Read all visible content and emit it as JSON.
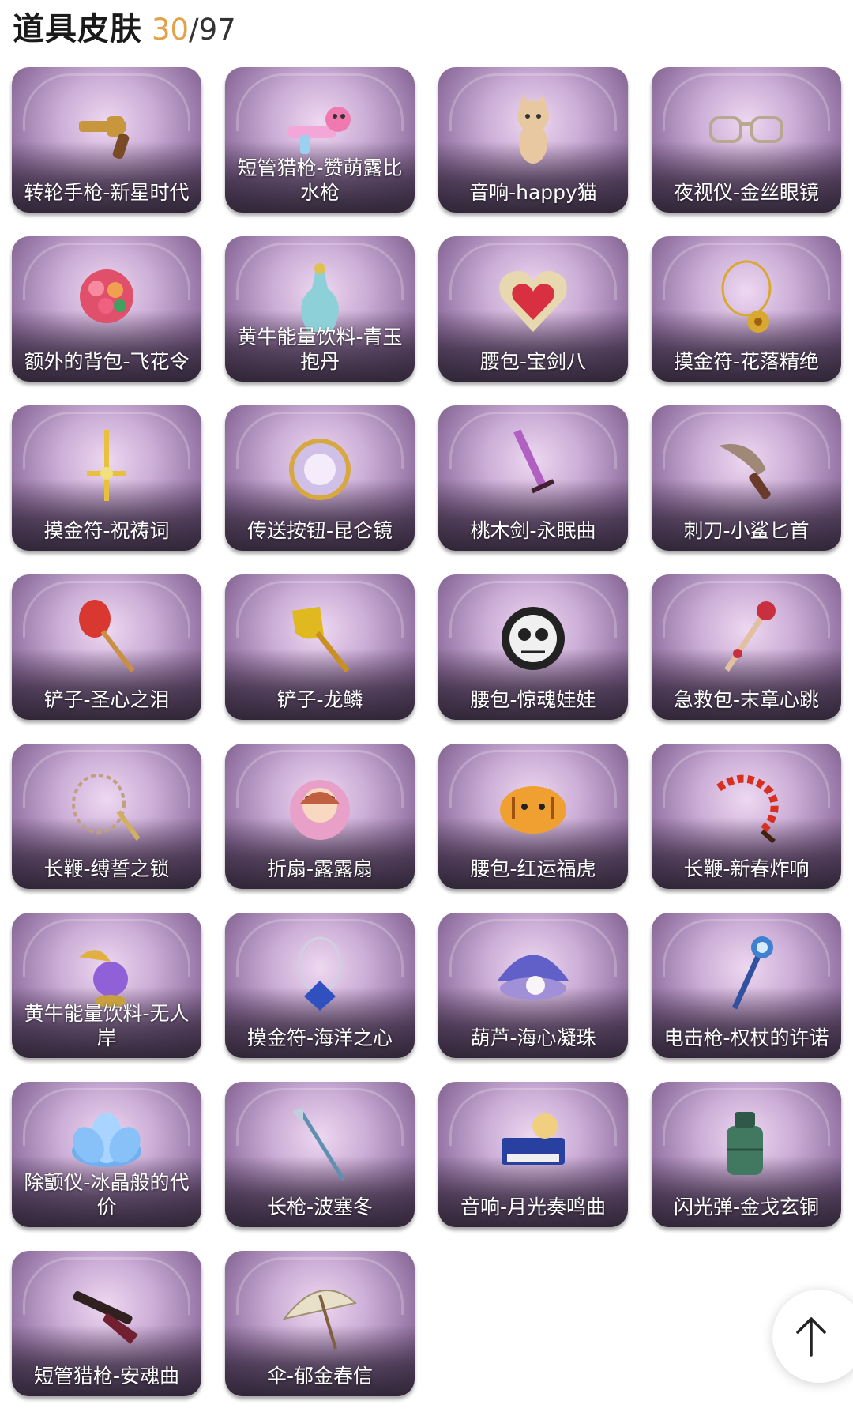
{
  "header": {
    "title": "道具皮肤",
    "count": "30",
    "slash": "/",
    "total": "97"
  },
  "items": [
    {
      "label": "转轮手枪-新星时代",
      "icon": "revolver-icon",
      "color": "#c8963c"
    },
    {
      "label": "短管猎枪-赞萌露比水枪",
      "icon": "water-gun-icon",
      "color": "#f2a7d8"
    },
    {
      "label": "音响-happy猫",
      "icon": "cat-icon",
      "color": "#e8c8a0"
    },
    {
      "label": "夜视仪-金丝眼镜",
      "icon": "glasses-icon",
      "color": "#b8a890"
    },
    {
      "label": "额外的背包-飞花令",
      "icon": "flower-bouquet-icon",
      "color": "#e0506a"
    },
    {
      "label": "黄牛能量饮料-青玉抱丹",
      "icon": "vase-icon",
      "color": "#8ed0d8"
    },
    {
      "label": "腰包-宝剑八",
      "icon": "heart-badge-icon",
      "color": "#d83040"
    },
    {
      "label": "摸金符-花落精绝",
      "icon": "golden-flower-pendant-icon",
      "color": "#d8a830"
    },
    {
      "label": "摸金符-祝祷词",
      "icon": "cross-pendant-icon",
      "color": "#e8c040"
    },
    {
      "label": "传送按钮-昆仑镜",
      "icon": "mirror-icon",
      "color": "#d0c0e8"
    },
    {
      "label": "桃木剑-永眠曲",
      "icon": "sword-icon",
      "color": "#b060c0"
    },
    {
      "label": "刺刀-小鲨匕首",
      "icon": "shark-knife-icon",
      "color": "#a08878"
    },
    {
      "label": "铲子-圣心之泪",
      "icon": "red-shovel-icon",
      "color": "#d83830"
    },
    {
      "label": "铲子-龙鳞",
      "icon": "gold-shovel-icon",
      "color": "#e0b820"
    },
    {
      "label": "腰包-惊魂娃娃",
      "icon": "skull-doll-icon",
      "color": "#f0f0f0"
    },
    {
      "label": "急救包-末章心跳",
      "icon": "heart-scepter-icon",
      "color": "#c83040"
    },
    {
      "label": "长鞭-缚誓之锁",
      "icon": "chain-whip-icon",
      "color": "#c0a080"
    },
    {
      "label": "折扇-露露扇",
      "icon": "anime-girl-fan-icon",
      "color": "#e8a0c8"
    },
    {
      "label": "腰包-红运福虎",
      "icon": "tiger-pouch-icon",
      "color": "#f0a030"
    },
    {
      "label": "长鞭-新春炸响",
      "icon": "firecracker-whip-icon",
      "color": "#d83020"
    },
    {
      "label": "黄牛能量饮料-无人岸",
      "icon": "crystal-orb-icon",
      "color": "#9060d8"
    },
    {
      "label": "摸金符-海洋之心",
      "icon": "blue-gem-pendant-icon",
      "color": "#3050c0"
    },
    {
      "label": "葫芦-海心凝珠",
      "icon": "pearl-shell-icon",
      "color": "#6060c8"
    },
    {
      "label": "电击枪-权杖的许诺",
      "icon": "blue-scepter-icon",
      "color": "#4080d0"
    },
    {
      "label": "除颤仪-冰晶般的代价",
      "icon": "ice-lotus-icon",
      "color": "#70b0f0"
    },
    {
      "label": "长枪-波塞冬",
      "icon": "trident-spear-icon",
      "color": "#6090b0"
    },
    {
      "label": "音响-月光奏鸣曲",
      "icon": "piano-icon",
      "color": "#2840a0"
    },
    {
      "label": "闪光弹-金戈玄铜",
      "icon": "bronze-grenade-icon",
      "color": "#407860"
    },
    {
      "label": "短管猎枪-安魂曲",
      "icon": "dark-shotgun-icon",
      "color": "#702030"
    },
    {
      "label": "伞-郁金春信",
      "icon": "umbrella-icon",
      "color": "#e8e0c8"
    }
  ],
  "scroll_top": {
    "icon": "arrow-up-icon"
  }
}
